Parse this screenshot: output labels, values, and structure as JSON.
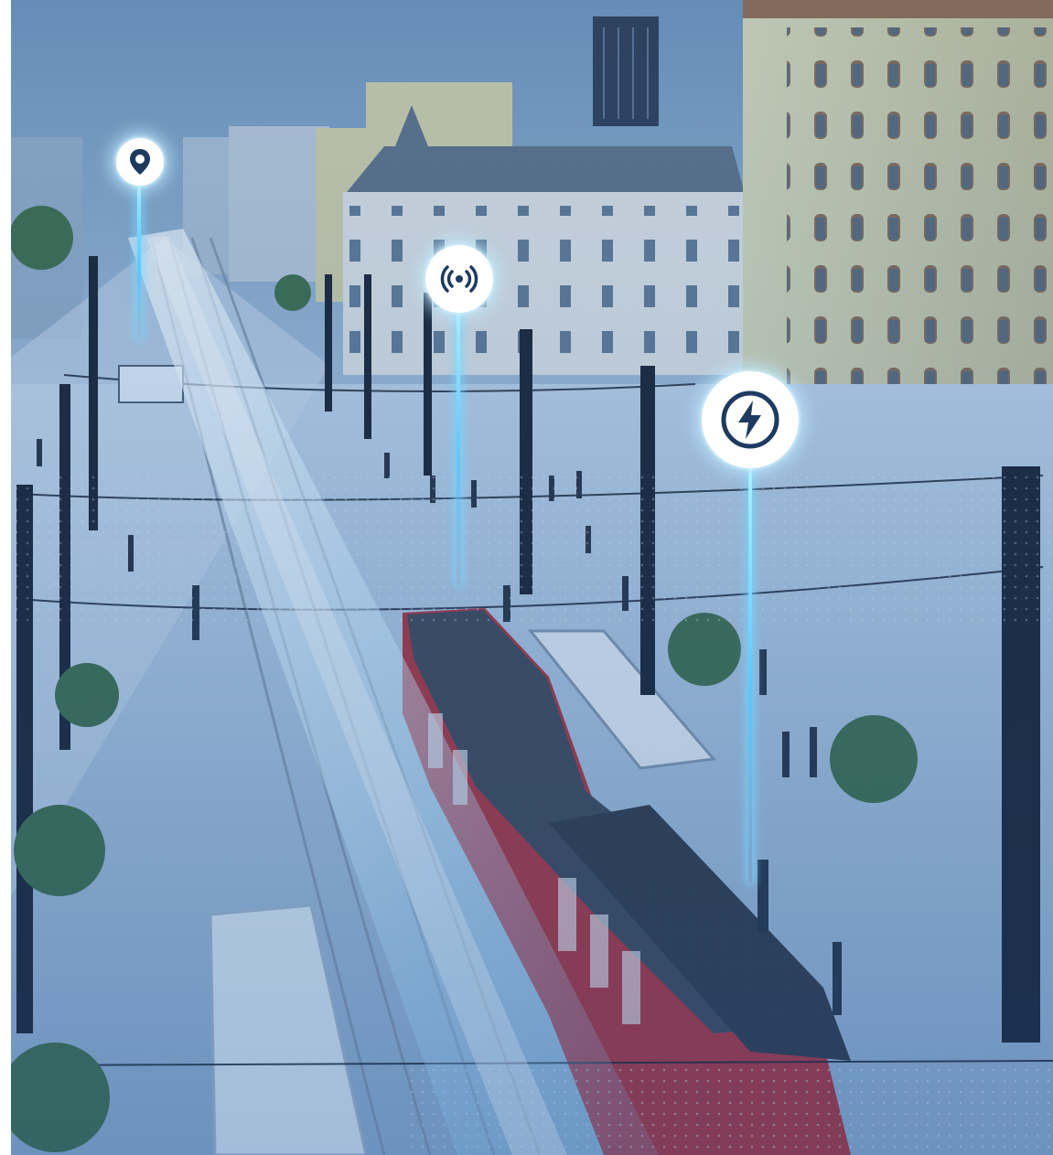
{
  "scene": {
    "description_alt": "",
    "markers": [
      {
        "id": "location",
        "icon": "location-pin-icon"
      },
      {
        "id": "signal",
        "icon": "wireless-signal-icon"
      },
      {
        "id": "energy",
        "icon": "lightning-bolt-icon"
      }
    ],
    "signs": {
      "store_sign": "",
      "building_sign": ""
    }
  },
  "colors": {
    "tint": "#2f6fb0",
    "sky": "#7fa3c4",
    "beam": "#9fe6ff",
    "icon_dark": "#1e3a5f",
    "tram_red": "#a8323d"
  }
}
